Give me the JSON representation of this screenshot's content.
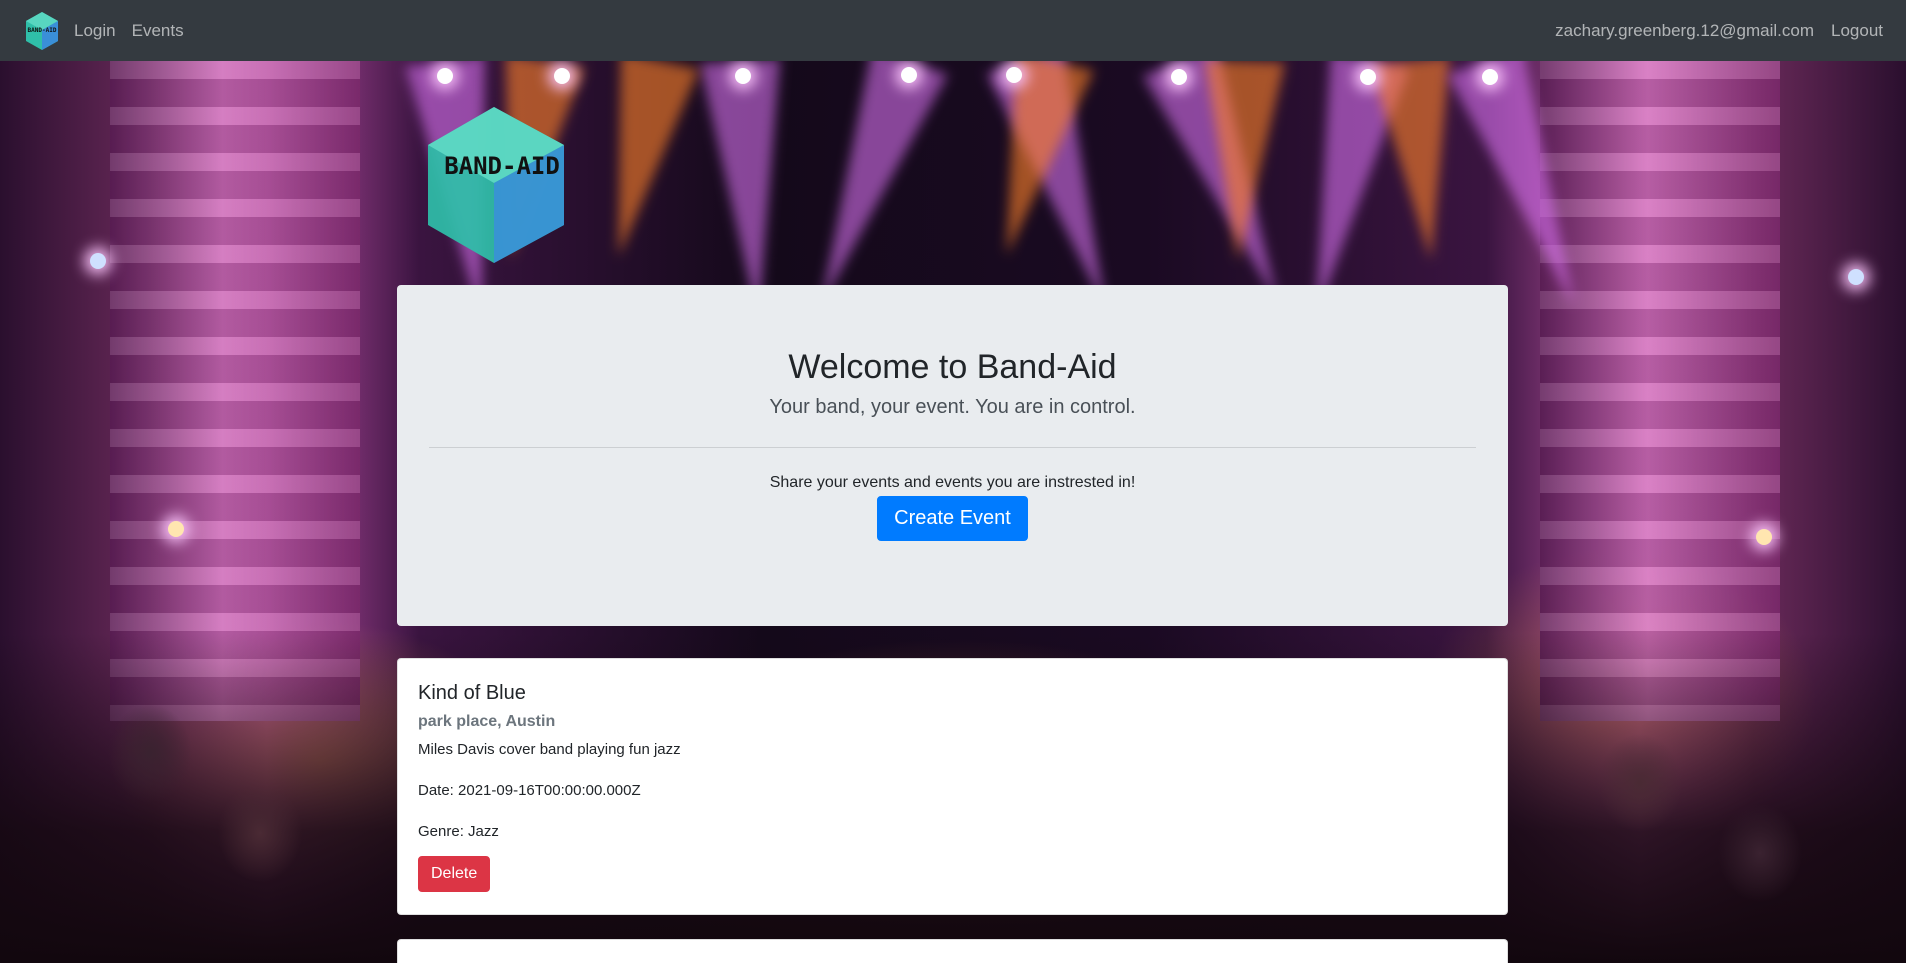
{
  "navbar": {
    "brand_logo_text": "BAND-AID",
    "links": [
      {
        "label": "Login"
      },
      {
        "label": "Events"
      }
    ],
    "user_email": "zachary.greenberg.12@gmail.com",
    "logout_label": "Logout"
  },
  "hero": {
    "logo_text": "BAND-AID"
  },
  "jumbotron": {
    "title": "Welcome to Band-Aid",
    "lead": "Your band, your event. You are in control.",
    "text": "Share your events and events you are instrested in!",
    "button_label": "Create Event"
  },
  "events": [
    {
      "title": "Kind of Blue",
      "location": "park place, Austin",
      "description": "Miles Davis cover band playing fun jazz",
      "date": "Date: 2021-09-16T00:00:00.000Z",
      "genre": "Genre: Jazz",
      "delete_label": "Delete"
    }
  ],
  "colors": {
    "navbar_bg": "#343a40",
    "primary": "#007bff",
    "danger": "#dc3545",
    "jumbotron_bg": "#e9ecef",
    "logo_teal": "#2fbfa9",
    "logo_blue": "#3a8fd8"
  }
}
